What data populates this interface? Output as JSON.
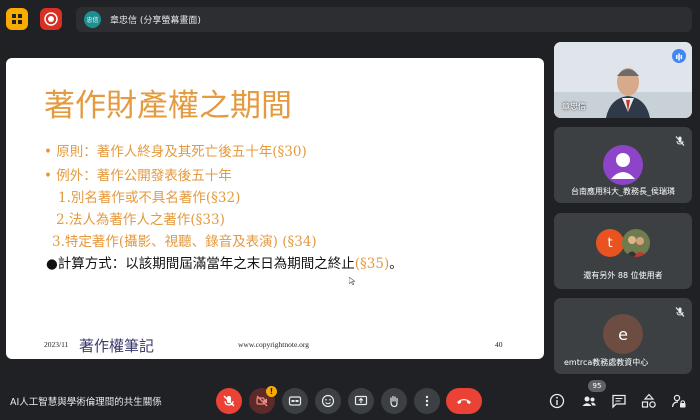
{
  "top": {
    "presenter_initials": "忠信",
    "presenter_label": "章忠信 (分享螢幕畫面)"
  },
  "slide": {
    "title": "著作財產權之期間",
    "lines": [
      {
        "text": "• 原則：著作人終身及其死亡後五十年",
        "ref": "(§30)"
      },
      {
        "text": "• 例外：著作公開發表後五十年",
        "ref": ""
      },
      {
        "text": "1.別名著作或不具名著作",
        "ref": "(§32)"
      },
      {
        "text": "2.法人為著作人之著作",
        "ref": "(§33)"
      },
      {
        "text": "3.特定著作(攝影、視聽、錄音及表演)",
        "ref": " (§34)"
      },
      {
        "text": "●計算方式：以該期間屆滿當年之末日為期間之終止",
        "ref": "(§35)",
        "tail": "。"
      }
    ],
    "footer_date": "2023/11",
    "footer_logo": "著作權筆記",
    "footer_url": "www.copyrightnote.org",
    "page_number": "40"
  },
  "participants": [
    {
      "name": "章忠信",
      "type": "video"
    },
    {
      "name": "台南應用科大_教務長_侯瑞璘",
      "type": "avatar",
      "initial": "",
      "color": "#8e44c9"
    },
    {
      "name": "還有另外 88 位使用者",
      "type": "group",
      "initial": "t",
      "color": "#e8531f"
    },
    {
      "name": "emtrca教務處教資中心",
      "type": "avatar",
      "initial": "e",
      "color": "#6d4c41"
    }
  ],
  "bottom": {
    "meeting_title": "AI人工智慧與學術倫理間的共生關係",
    "participant_count": "95",
    "alert_badge": "!"
  },
  "colors": {
    "bg": "#202124",
    "slide_orange": "#e49a3f",
    "red": "#ea4335",
    "tile": "#3c4043"
  }
}
